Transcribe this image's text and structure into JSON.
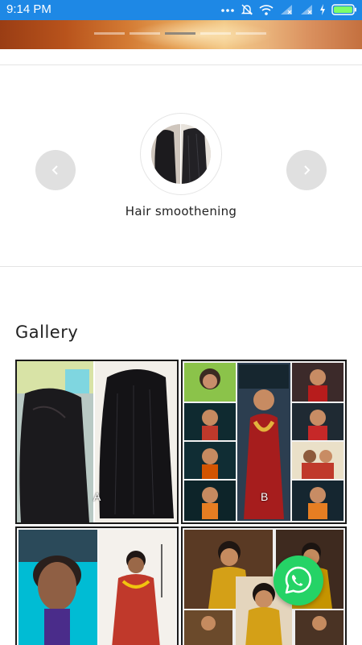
{
  "status_bar": {
    "time": "9:14 PM",
    "icons": [
      "more-dots-icon",
      "mute-icon",
      "wifi-icon",
      "signal-icon",
      "signal-icon",
      "charging-icon",
      "battery-icon"
    ],
    "battery_color": "#7cff6a"
  },
  "banner": {
    "slide_count": 5,
    "active_slide": 3
  },
  "services": {
    "current": "Hair smoothening",
    "prev_icon": "chevron-left-icon",
    "next_icon": "chevron-right-icon"
  },
  "gallery": {
    "title": "Gallery",
    "tiles": [
      {
        "label": "A"
      },
      {
        "label": "B"
      },
      {
        "label": ""
      },
      {
        "label": ""
      }
    ]
  },
  "fab": {
    "icon": "whatsapp-icon",
    "color": "#25d366"
  }
}
